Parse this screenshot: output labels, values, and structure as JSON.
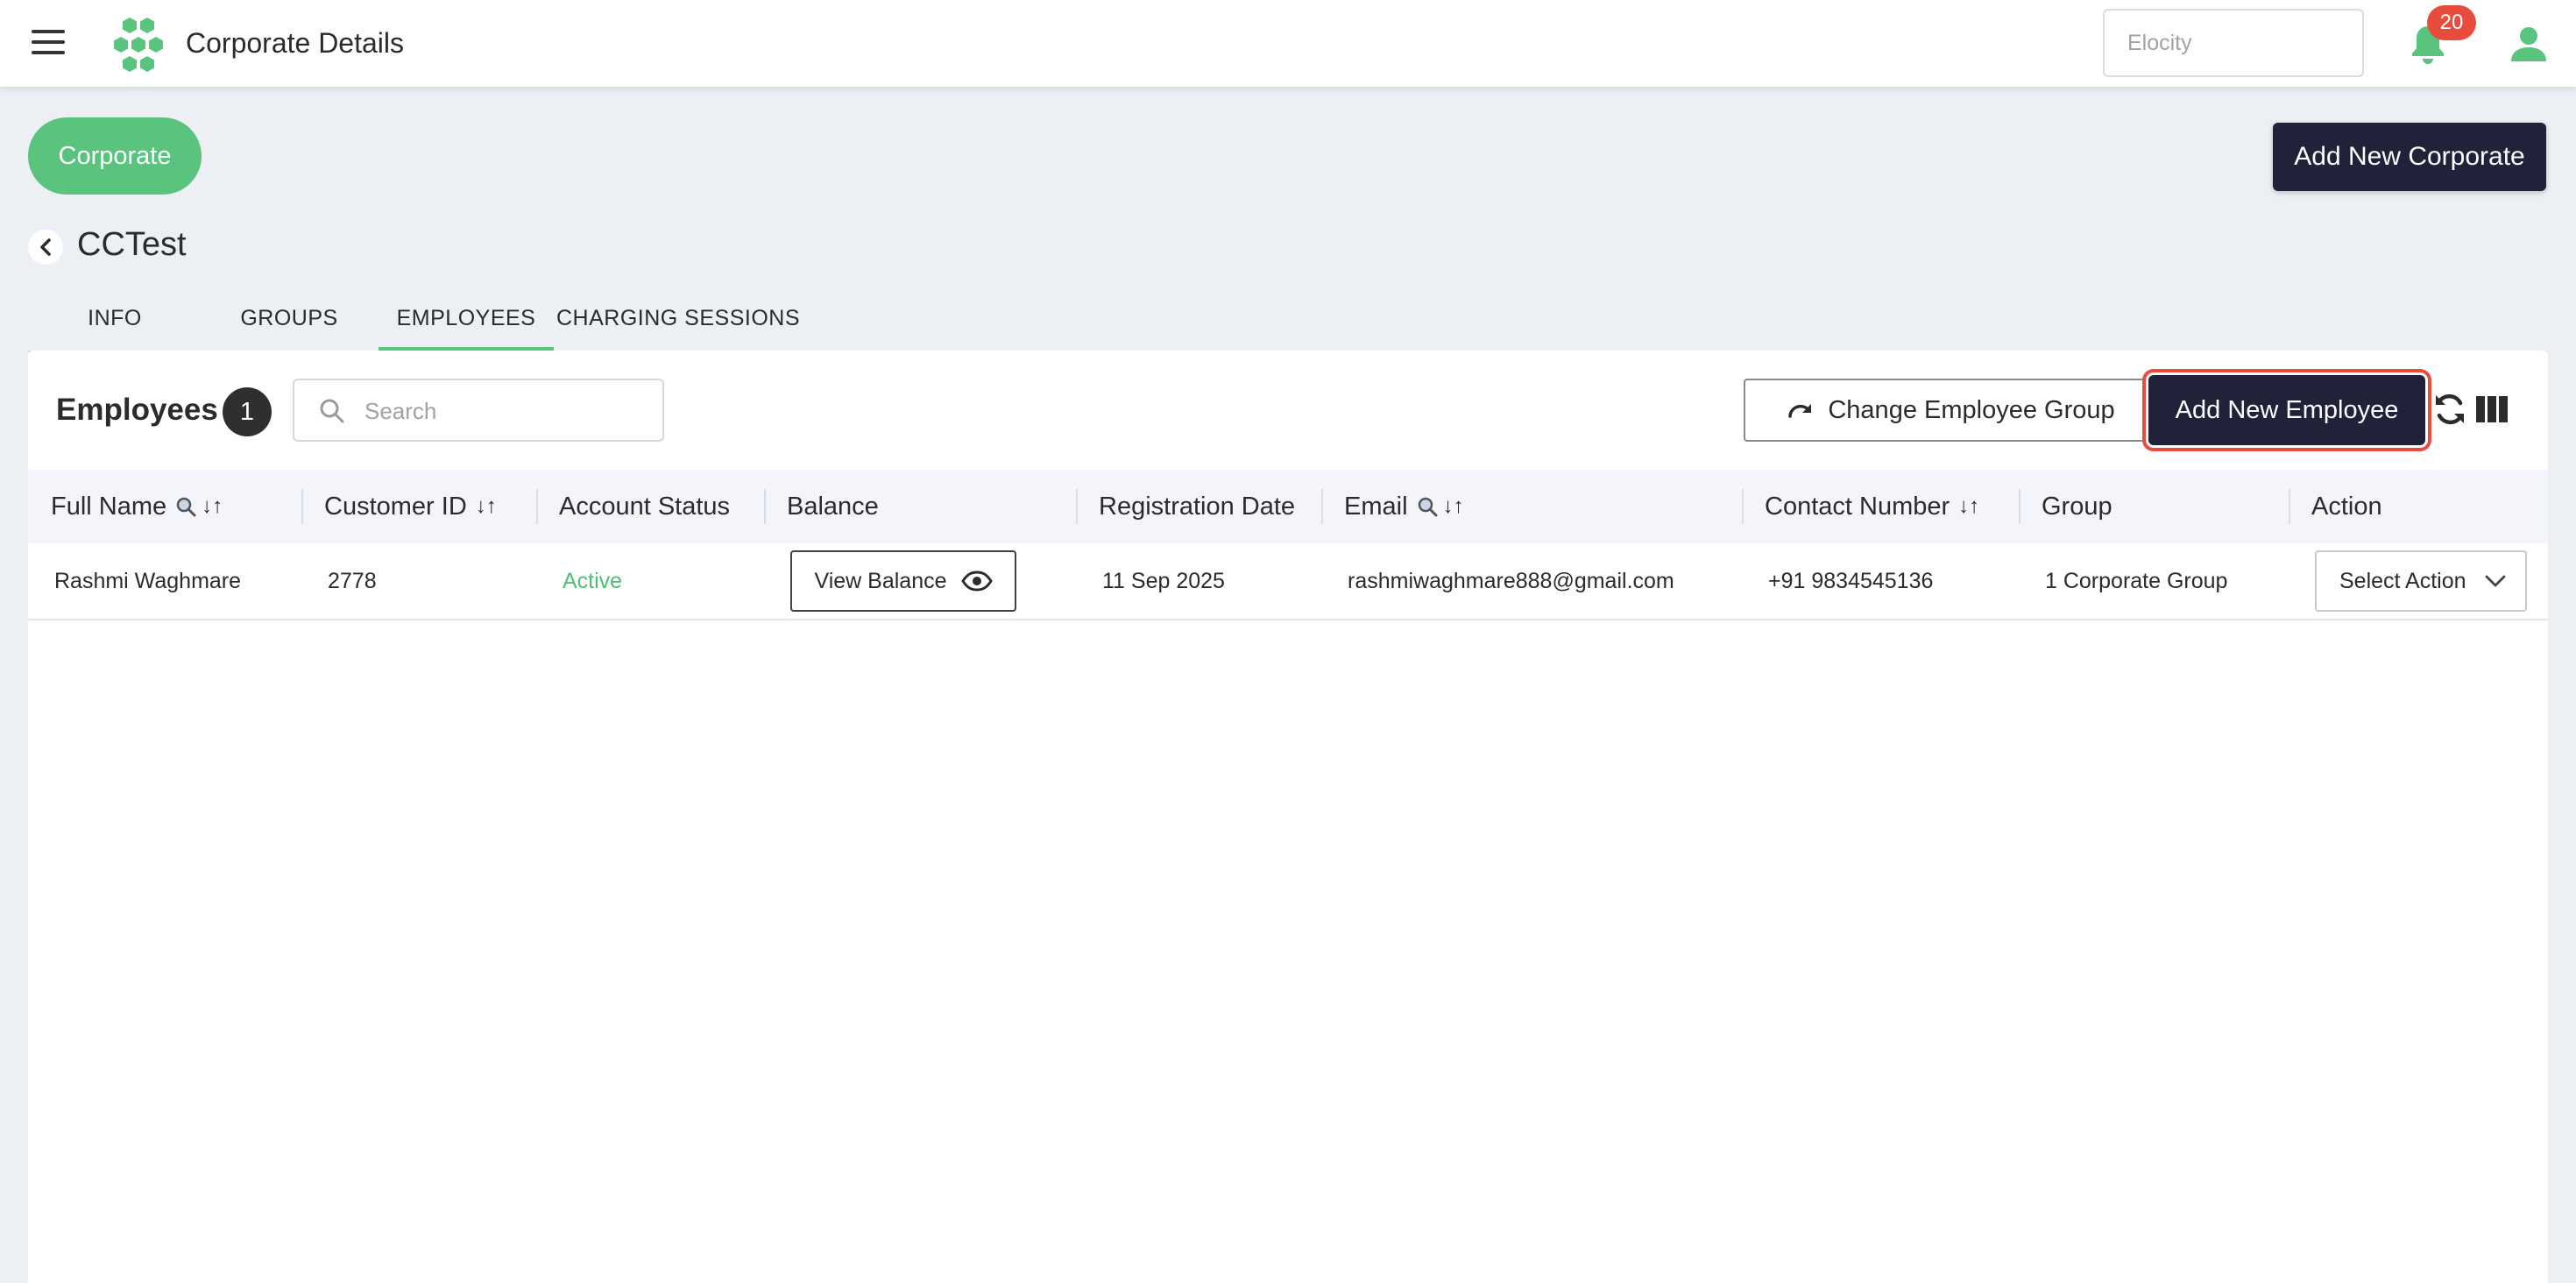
{
  "header": {
    "title": "Corporate Details",
    "search_placeholder": "Elocity",
    "notification_count": "20"
  },
  "page": {
    "corporate_pill": "Corporate",
    "add_corporate_label": "Add New Corporate",
    "entity_title": "CCTest"
  },
  "tabs": [
    {
      "label": "INFO",
      "active": false
    },
    {
      "label": "GROUPS",
      "active": false
    },
    {
      "label": "EMPLOYEES",
      "active": true
    },
    {
      "label": "CHARGING SESSIONS",
      "active": false
    }
  ],
  "employees": {
    "title": "Employees",
    "count": "1",
    "search_placeholder": "Search",
    "change_group_label": "Change Employee Group",
    "add_employee_label": "Add New Employee"
  },
  "table": {
    "columns": [
      "Full Name",
      "Customer ID",
      "Account Status",
      "Balance",
      "Registration Date",
      "Email",
      "Contact Number",
      "Group",
      "Action"
    ],
    "sort_glyph": "↓↑",
    "rows": [
      {
        "full_name": "Rashmi Waghmare",
        "customer_id": "2778",
        "account_status": "Active",
        "balance_button": "View Balance",
        "registration_date": "11 Sep 2025",
        "email": "rashmiwaghmare888@gmail.com",
        "contact_number": "+91 9834545136",
        "group": "1 Corporate Group",
        "action_placeholder": "Select Action"
      }
    ]
  },
  "colors": {
    "accent_green": "#5ac37d",
    "navy": "#1f2239",
    "badge_red": "#e74c3c"
  }
}
